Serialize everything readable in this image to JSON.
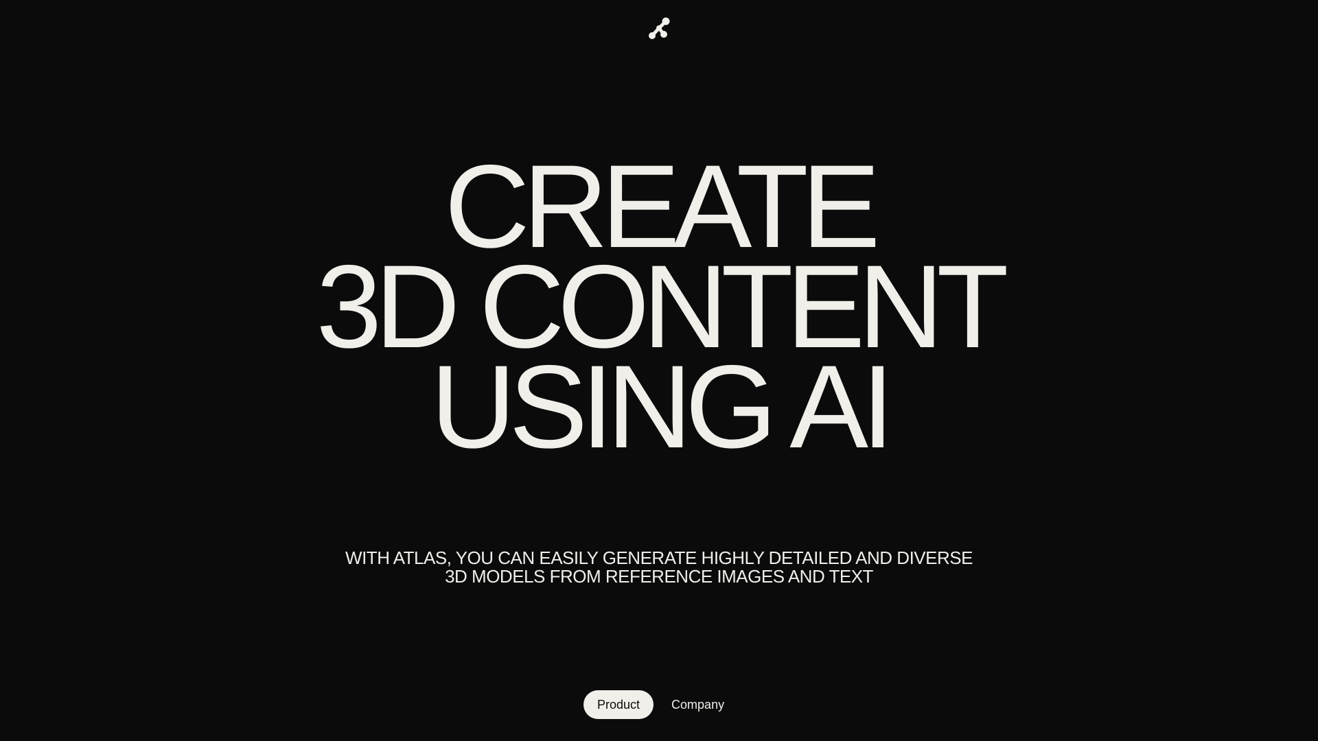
{
  "brand": {
    "logo_icon": "atlas-molecule-logo"
  },
  "hero": {
    "headline_lines": [
      "CREATE",
      "3D CONTENT",
      "USING AI"
    ],
    "subtitle_lines": [
      "WITH ATLAS, YOU CAN EASILY GENERATE HIGHLY DETAILED AND DIVERSE",
      "3D MODELS FROM REFERENCE IMAGES AND TEXT"
    ]
  },
  "nav": {
    "items": [
      {
        "label": "Product",
        "active": true
      },
      {
        "label": "Company",
        "active": false
      }
    ]
  },
  "colors": {
    "background": "#0b0b0b",
    "foreground": "#f1efea"
  }
}
